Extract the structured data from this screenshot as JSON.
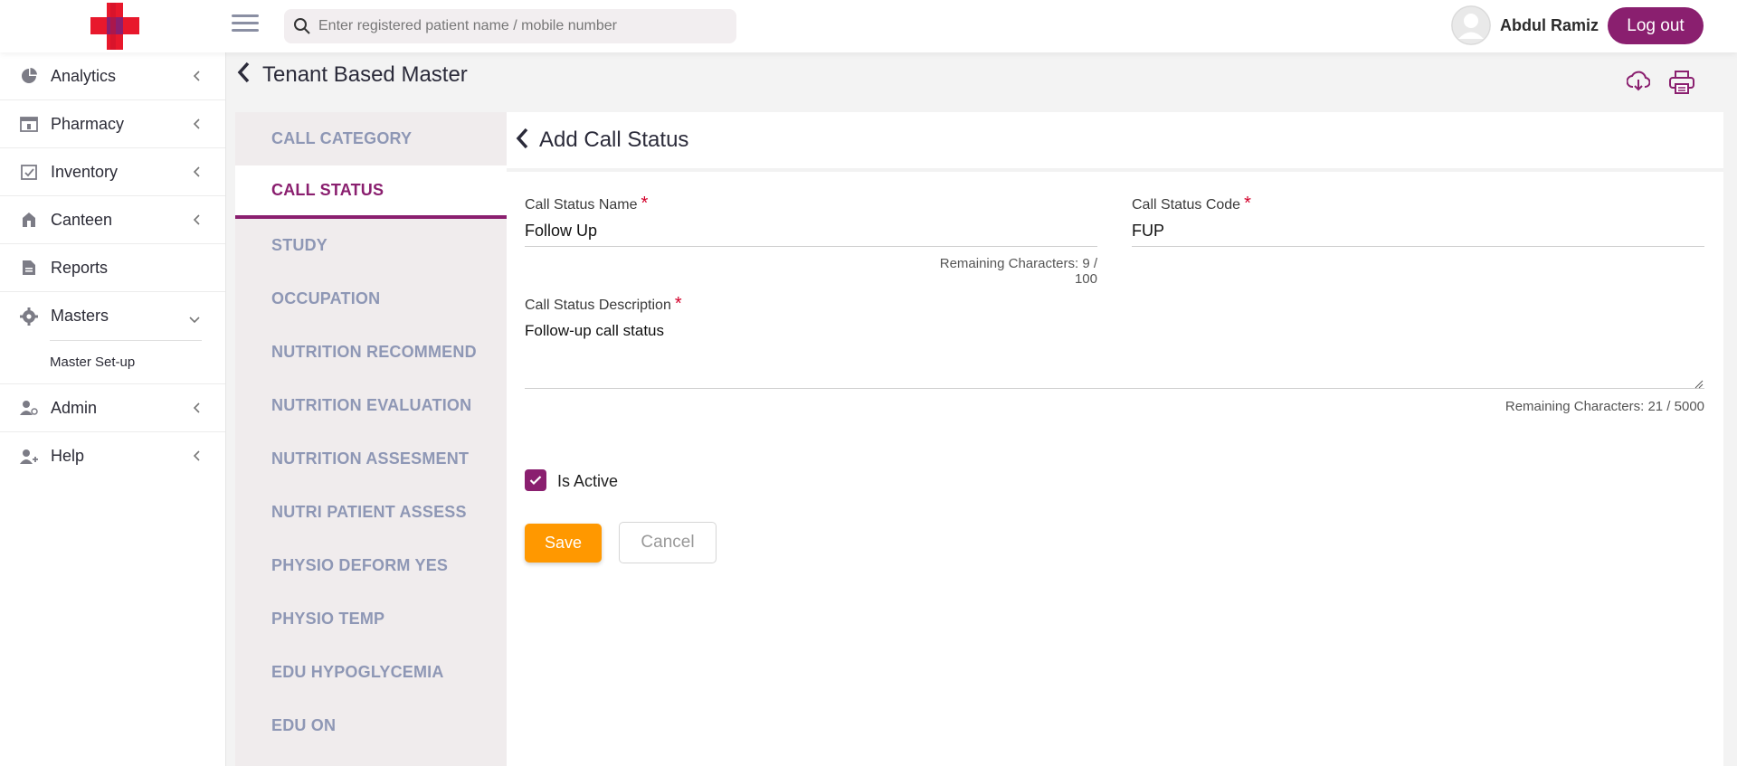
{
  "header": {
    "search_placeholder": "Enter registered patient name / mobile number",
    "user_name": "Abdul Ramiz",
    "logout_label": "Log out"
  },
  "sidebar": {
    "items": [
      {
        "label": "Analytics",
        "icon": "pie-chart-icon"
      },
      {
        "label": "Pharmacy",
        "icon": "pharmacy-icon"
      },
      {
        "label": "Inventory",
        "icon": "clipboard-check-icon"
      },
      {
        "label": "Canteen",
        "icon": "canteen-icon"
      },
      {
        "label": "Reports",
        "icon": "document-icon"
      },
      {
        "label": "Masters",
        "icon": "gear-icon",
        "expanded": true
      },
      {
        "label": "Admin",
        "icon": "user-gear-icon"
      },
      {
        "label": "Help",
        "icon": "user-plus-icon"
      }
    ],
    "masters_sub": "Master Set-up"
  },
  "page": {
    "title": "Tenant Based Master"
  },
  "tabs": [
    "CALL CATEGORY",
    "CALL STATUS",
    "STUDY",
    "OCCUPATION",
    "NUTRITION RECOMMEND",
    "NUTRITION EVALUATION",
    "NUTRITION ASSESMENT",
    "NUTRI PATIENT ASSESS",
    "PHYSIO DEFORM YES",
    "PHYSIO TEMP",
    "EDU HYPOGLYCEMIA",
    "EDU ON"
  ],
  "active_tab": "CALL STATUS",
  "form": {
    "title": "Add Call Status",
    "name_label": "Call Status Name",
    "name_value": "Follow Up",
    "name_remaining": "Remaining Characters: 9 / 100",
    "code_label": "Call Status Code",
    "code_value": "FUP",
    "desc_label": "Call Status Description",
    "desc_value": "Follow-up call status",
    "desc_remaining": "Remaining Characters: 21 / 5000",
    "required_mark": "*",
    "is_active_label": "Is Active",
    "is_active": true,
    "save_label": "Save",
    "cancel_label": "Cancel"
  },
  "colors": {
    "brand": "#8a1f6f",
    "save": "#ff9800",
    "required": "#d3002a",
    "tab_inactive": "#8e97b5"
  }
}
